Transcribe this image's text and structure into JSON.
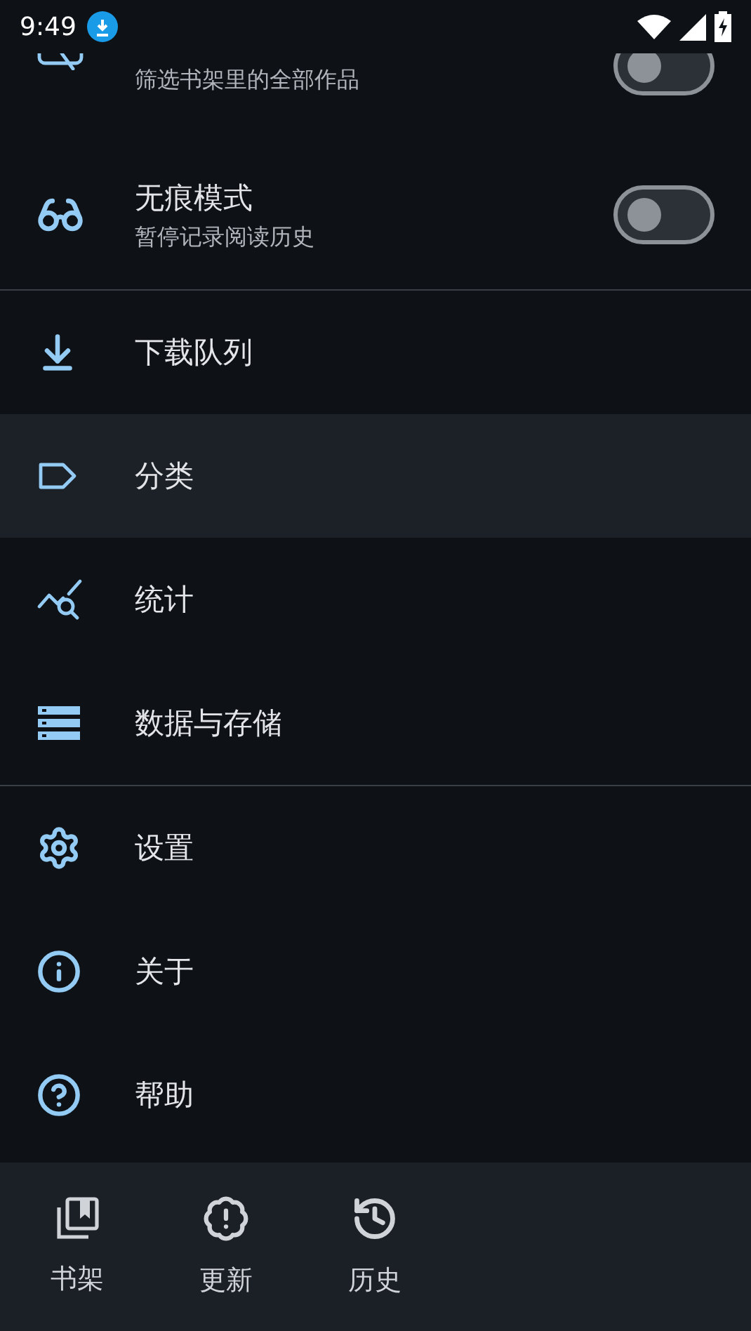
{
  "status_bar": {
    "time": "9:49"
  },
  "menu": [
    {
      "kind": "switch",
      "subtitle": "筛选书架里的全部作品",
      "on": false
    },
    {
      "kind": "switch",
      "title": "无痕模式",
      "subtitle": "暂停记录阅读历史",
      "on": false
    },
    {
      "kind": "divider"
    },
    {
      "kind": "link",
      "title": "下载队列",
      "selected": false
    },
    {
      "kind": "link",
      "title": "分类",
      "selected": true
    },
    {
      "kind": "link",
      "title": "统计",
      "selected": false
    },
    {
      "kind": "link",
      "title": "数据与存储",
      "selected": false
    },
    {
      "kind": "divider"
    },
    {
      "kind": "link",
      "title": "设置",
      "selected": false
    },
    {
      "kind": "link",
      "title": "关于",
      "selected": false
    },
    {
      "kind": "link",
      "title": "帮助",
      "selected": false
    }
  ],
  "bottom_nav": [
    {
      "label": "书架",
      "selected": false
    },
    {
      "label": "更新",
      "selected": false
    },
    {
      "label": "历史",
      "selected": false
    }
  ]
}
